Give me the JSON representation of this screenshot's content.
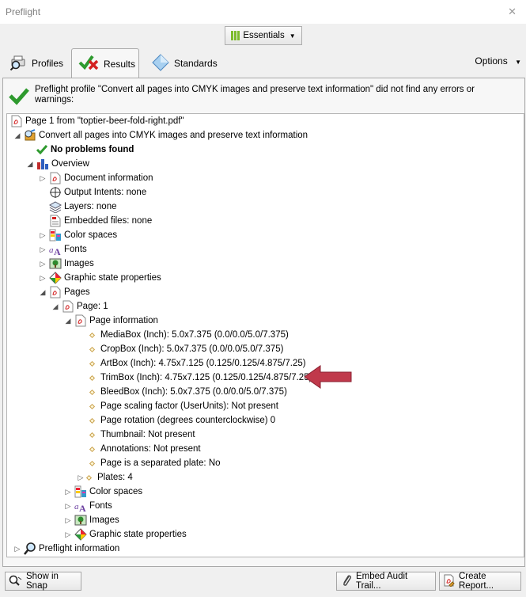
{
  "window": {
    "title": "Preflight",
    "close_glyph": "✕"
  },
  "toolbar": {
    "essentials_label": "Essentials",
    "essentials_icon": "bar-chart-icon"
  },
  "tabs": [
    {
      "label": "Profiles",
      "icon": "print-magnifier-icon"
    },
    {
      "label": "Results",
      "icon": "check-cross-icon"
    },
    {
      "label": "Standards",
      "icon": "diamond-icon"
    }
  ],
  "options_label": "Options",
  "summary": {
    "message": "Preflight profile \"Convert all pages into CMYK images and preserve text information\" did not find any errors or warnings:",
    "status_color": "#2e9a2e"
  },
  "tree": {
    "root": "Page 1 from \"toptier-beer-fold-right.pdf\"",
    "profile": "Convert all pages into CMYK images and preserve text information",
    "no_problems": "No problems found",
    "overview": "Overview",
    "document_information": "Document information",
    "output_intents": "Output Intents: none",
    "layers": "Layers: none",
    "embedded_files": "Embedded files: none",
    "color_spaces": "Color spaces",
    "fonts": "Fonts",
    "images": "Images",
    "graphic_state": "Graphic state properties",
    "pages": "Pages",
    "page_1": "Page: 1",
    "page_information": "Page information",
    "page_info_items": [
      "MediaBox (Inch): 5.0x7.375 (0.0/0.0/5.0/7.375)",
      "CropBox (Inch): 5.0x7.375 (0.0/0.0/5.0/7.375)",
      "ArtBox (Inch): 4.75x7.125 (0.125/0.125/4.875/7.25)",
      "TrimBox (Inch): 4.75x7.125 (0.125/0.125/4.875/7.25)",
      "BleedBox (Inch): 5.0x7.375 (0.0/0.0/5.0/7.375)",
      "Page scaling factor (UserUnits): Not present",
      "Page rotation (degrees counterclockwise) 0",
      "Thumbnail: Not present",
      "Annotations: Not present",
      "Page is a separated plate: No",
      "Plates: 4"
    ],
    "page_color_spaces": "Color spaces",
    "page_fonts": "Fonts",
    "page_images": "Images",
    "page_graphic_state": "Graphic state properties",
    "preflight_information": "Preflight information"
  },
  "buttons": {
    "show_in_snap": "Show in Snap",
    "embed_audit_trail": "Embed Audit Trail...",
    "create_report": "Create Report..."
  },
  "colors": {
    "annotation_arrow": "#c0394b",
    "check_green": "#2e9a2e"
  }
}
